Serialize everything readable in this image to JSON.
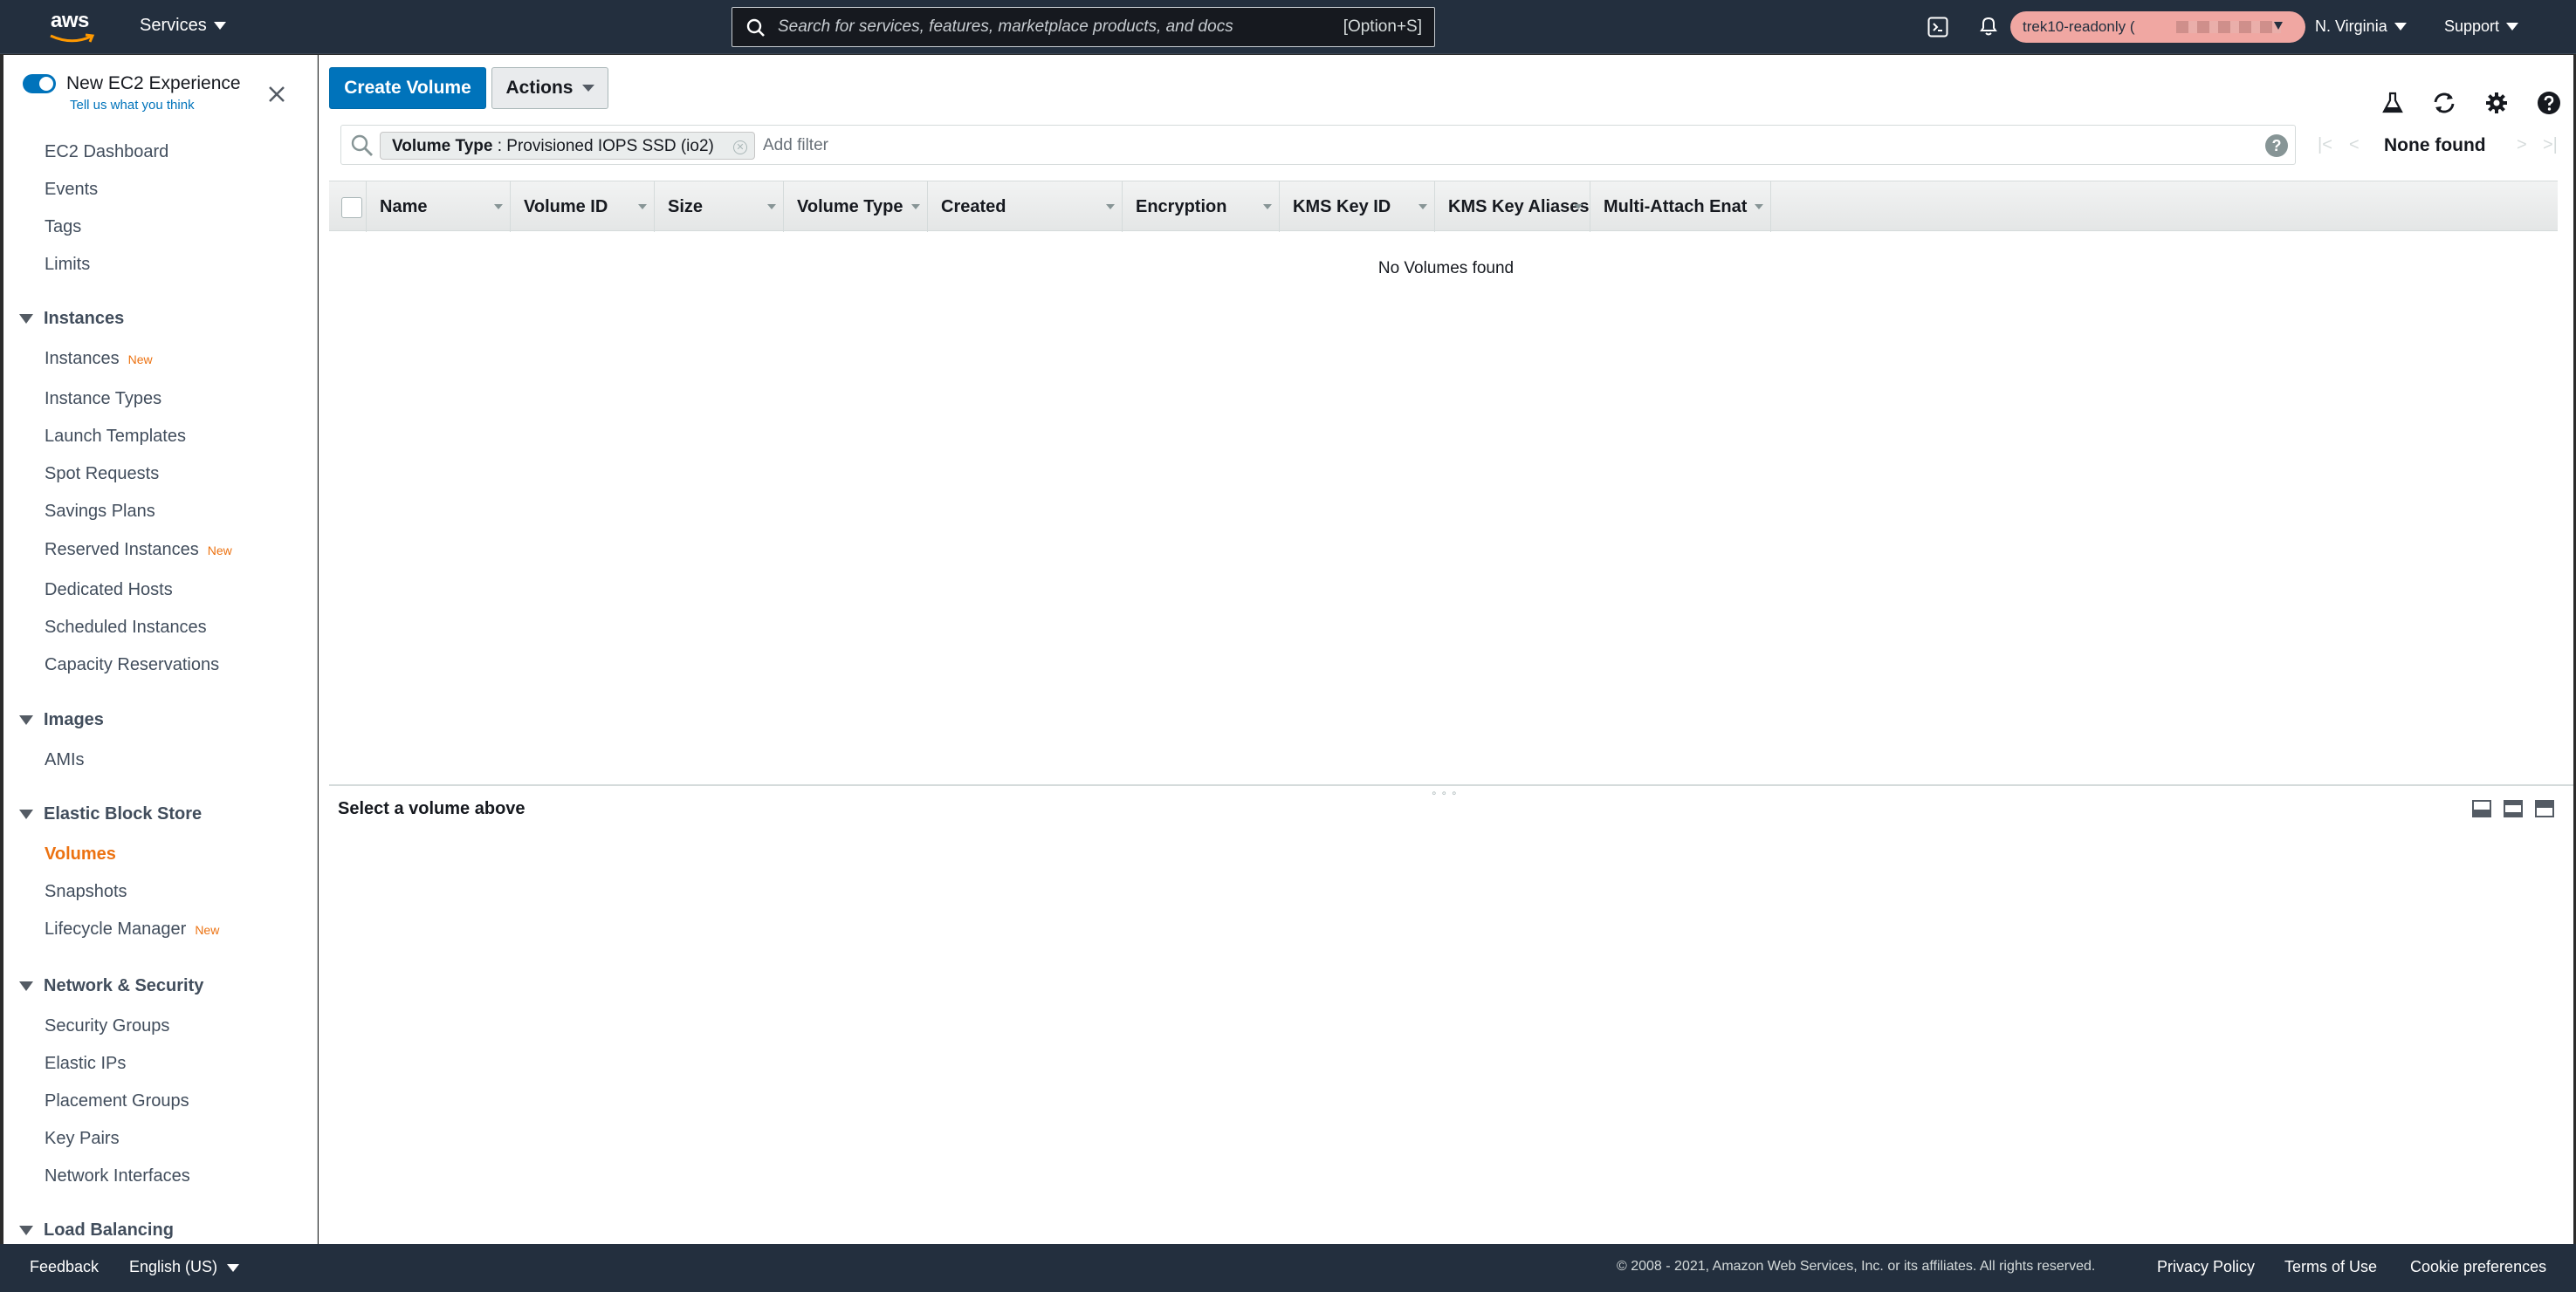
{
  "topnav": {
    "logo_text": "aws",
    "services_label": "Services",
    "search_placeholder": "Search for services, features, marketplace products, and docs",
    "search_shortcut": "[Option+S]",
    "account_label": "trek10-readonly (",
    "region_label": "N. Virginia",
    "support_label": "Support"
  },
  "sidebar": {
    "new_experience_title": "New EC2 Experience",
    "new_experience_feedback": "Tell us what you think",
    "top_items": [
      "EC2 Dashboard",
      "Events",
      "Tags",
      "Limits"
    ],
    "sections": [
      {
        "title": "Instances",
        "items": [
          {
            "label": "Instances",
            "badge": "New"
          },
          {
            "label": "Instance Types"
          },
          {
            "label": "Launch Templates"
          },
          {
            "label": "Spot Requests"
          },
          {
            "label": "Savings Plans"
          },
          {
            "label": "Reserved Instances",
            "badge": "New"
          },
          {
            "label": "Dedicated Hosts"
          },
          {
            "label": "Scheduled Instances"
          },
          {
            "label": "Capacity Reservations"
          }
        ]
      },
      {
        "title": "Images",
        "items": [
          {
            "label": "AMIs"
          }
        ]
      },
      {
        "title": "Elastic Block Store",
        "items": [
          {
            "label": "Volumes",
            "active": true
          },
          {
            "label": "Snapshots"
          },
          {
            "label": "Lifecycle Manager",
            "badge": "New"
          }
        ]
      },
      {
        "title": "Network & Security",
        "items": [
          {
            "label": "Security Groups"
          },
          {
            "label": "Elastic IPs"
          },
          {
            "label": "Placement Groups"
          },
          {
            "label": "Key Pairs"
          },
          {
            "label": "Network Interfaces"
          }
        ]
      },
      {
        "title": "Load Balancing",
        "items": []
      }
    ]
  },
  "toolbar": {
    "create_label": "Create Volume",
    "actions_label": "Actions"
  },
  "filter": {
    "chip_key": "Volume Type",
    "chip_value": ": Provisioned IOPS SSD (io2)",
    "add_placeholder": "Add filter"
  },
  "pager": {
    "status": "None found"
  },
  "table": {
    "columns": [
      "Name",
      "Volume ID",
      "Size",
      "Volume Type",
      "Created",
      "Encryption",
      "KMS Key ID",
      "KMS Key Aliases",
      "Multi-Attach Enat"
    ],
    "empty_message": "No Volumes found"
  },
  "detail": {
    "title": "Select a volume above"
  },
  "footer": {
    "feedback": "Feedback",
    "language": "English (US)",
    "copyright": "© 2008 - 2021, Amazon Web Services, Inc. or its affiliates. All rights reserved.",
    "privacy": "Privacy Policy",
    "terms": "Terms of Use",
    "cookies": "Cookie preferences"
  },
  "colors": {
    "nav_bg": "#232f3e",
    "primary_button": "#0073bb",
    "active_nav": "#ec7211",
    "account_pill": "#f0a7a2"
  },
  "icons": [
    "search-icon",
    "cloudshell-icon",
    "bell-icon",
    "close-icon",
    "beaker-icon",
    "refresh-icon",
    "gear-icon",
    "help-icon"
  ]
}
